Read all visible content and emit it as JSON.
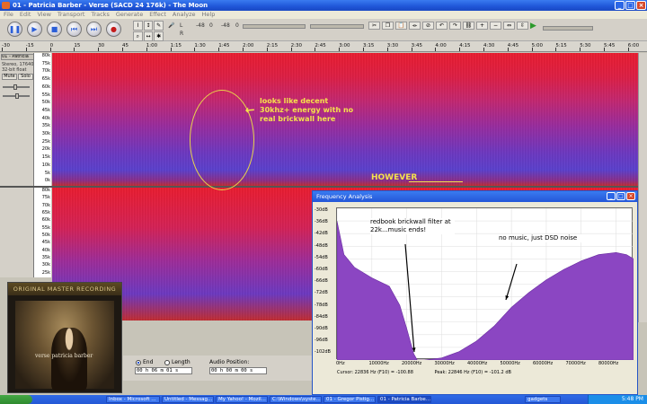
{
  "window": {
    "title": "01 - Patricia Barber - Verse (SACD 24 176k) - The Moon"
  },
  "menu": [
    "File",
    "Edit",
    "View",
    "Transport",
    "Tracks",
    "Generate",
    "Effect",
    "Analyze",
    "Help"
  ],
  "meters": {
    "L": "L",
    "R": "R",
    "scale": [
      "-48",
      "0",
      "-48",
      "0"
    ]
  },
  "ruler": [
    "-30",
    "-15",
    "0",
    "15",
    "30",
    "45",
    "1:00",
    "1:15",
    "1:30",
    "1:45",
    "2:00",
    "2:15",
    "2:30",
    "2:45",
    "3:00",
    "3:15",
    "3:30",
    "3:45",
    "4:00",
    "4:15",
    "4:30",
    "4:45",
    "5:00",
    "5:15",
    "5:30",
    "5:45",
    "6:00"
  ],
  "track": {
    "name": "01 - Patricia",
    "info": [
      "Stereo, 176400Hz",
      "32-bit float"
    ],
    "mute": "Mute",
    "solo": "Solo",
    "freq_labels_top": [
      "80k",
      "75k",
      "70k",
      "65k",
      "60k",
      "55k",
      "50k",
      "45k",
      "40k",
      "35k",
      "30k",
      "25k",
      "20k",
      "15k",
      "10k",
      "5k",
      "0k"
    ],
    "freq_labels_bottom": [
      "80k",
      "75k",
      "70k",
      "65k",
      "60k",
      "55k",
      "50k",
      "45k",
      "40k",
      "35k",
      "30k",
      "25k"
    ]
  },
  "annotations": {
    "ellipse_note": "looks like decent 30khz+ energy with no real brickwall here",
    "however": "HOWEVER"
  },
  "album": {
    "band": "ORIGINAL MASTER RECORDING",
    "artist": "verse  patricia barber"
  },
  "selection_bar": {
    "end_label": "End",
    "length_label": "Length",
    "audio_position_label": "Audio Position:",
    "end_value": "00 h 06 m 01 s",
    "audio_position_value": "00 h 00 m 00 s"
  },
  "freq_analysis": {
    "title": "Frequency Analysis",
    "db_labels": [
      "-30dB",
      "-36dB",
      "-42dB",
      "-48dB",
      "-54dB",
      "-60dB",
      "-66dB",
      "-72dB",
      "-78dB",
      "-84dB",
      "-90dB",
      "-96dB",
      "-102dB"
    ],
    "hz_labels": [
      "0Hz",
      "10000Hz",
      "20000Hz",
      "30000Hz",
      "40000Hz",
      "50000Hz",
      "60000Hz",
      "70000Hz",
      "80000Hz"
    ],
    "cursor": "Cursor: 22836 Hz (F10) = -100.88",
    "peak": "Peak: 22846 Hz (F10) = -101.2 dB",
    "note_left": "redbook brickwall filter at 22k...music ends!",
    "note_right": "no music, just DSD noise"
  },
  "taskbar": {
    "items": [
      "Inbox - Microsoft ...",
      "Untitled - Messag...",
      "My Yahoo! - Mozil...",
      "C:\\Windows\\syste...",
      "01 - Gregor Pistig...",
      "01 - Patricia Barbe...",
      "gadgets"
    ],
    "clock": "5:48 PM"
  },
  "chart_data": {
    "type": "area",
    "title": "Frequency Analysis",
    "xlabel": "",
    "ylabel": "",
    "xlim": [
      0,
      85000
    ],
    "ylim": [
      -102,
      -30
    ],
    "x": [
      0,
      2000,
      5000,
      10000,
      15000,
      18000,
      20000,
      22000,
      23000,
      25000,
      30000,
      35000,
      40000,
      45000,
      50000,
      55000,
      60000,
      65000,
      70000,
      75000,
      80000,
      83000,
      85000
    ],
    "y": [
      -36,
      -52,
      -58,
      -63,
      -67,
      -76,
      -87,
      -99,
      -102,
      -102,
      -101,
      -98,
      -93,
      -86,
      -77,
      -70,
      -64,
      -59,
      -55,
      -52,
      -51,
      -52,
      -54
    ],
    "grid": true,
    "color": "#8b46c2"
  }
}
